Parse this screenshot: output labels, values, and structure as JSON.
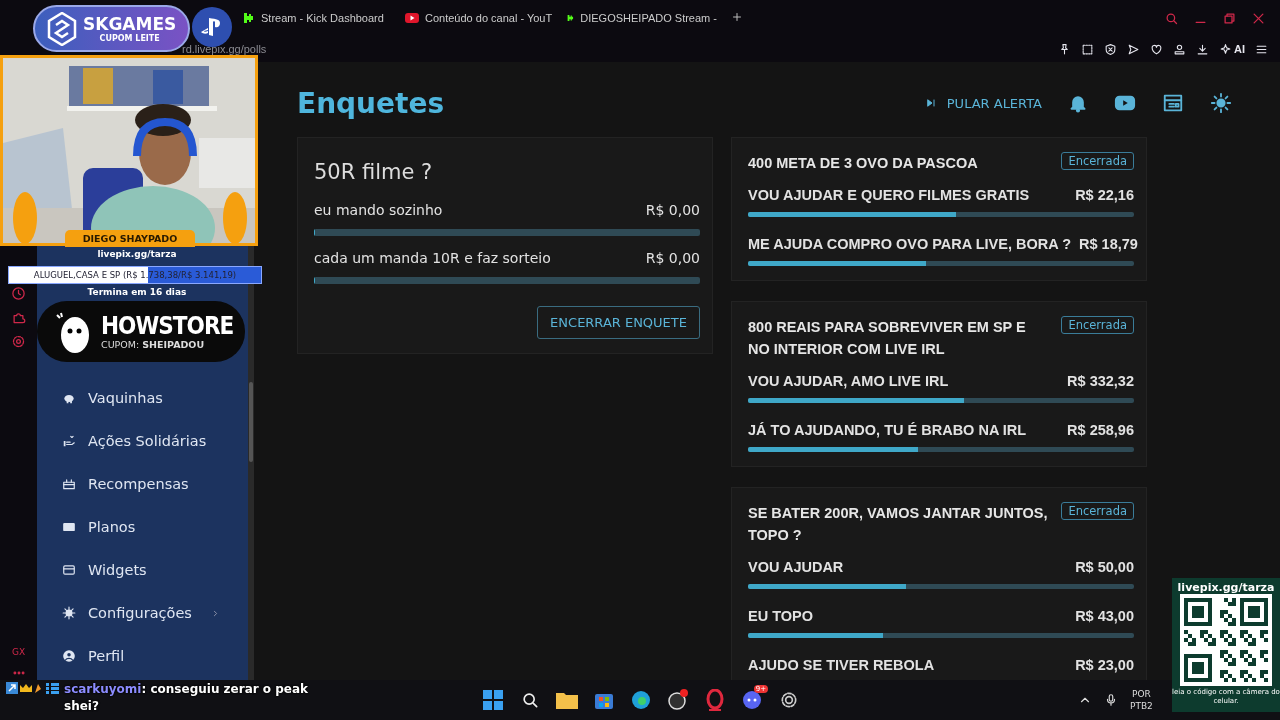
{
  "browser": {
    "tabs": [
      {
        "kind": "kick",
        "title": "Stream - Kick Dashboard"
      },
      {
        "kind": "youtube",
        "title": "Conteúdo do canal - YouT"
      },
      {
        "kind": "kick",
        "title": "DIEGOSHEIPADO Stream -"
      }
    ],
    "address": "rd.livepix.gg/polls",
    "ai_label": "AI"
  },
  "opera_sidebar": {
    "badge": "GX"
  },
  "sidebar": {
    "items": [
      {
        "label": "Vaquinhas",
        "has_submenu": false
      },
      {
        "label": "Ações Solidárias",
        "has_submenu": false
      },
      {
        "label": "Recompensas",
        "has_submenu": false
      },
      {
        "label": "Planos",
        "has_submenu": false
      },
      {
        "label": "Widgets",
        "has_submenu": false
      },
      {
        "label": "Configurações",
        "has_submenu": true
      },
      {
        "label": "Perfil",
        "has_submenu": false
      }
    ]
  },
  "page": {
    "title": "Enquetes",
    "skip_alert": "PULAR ALERTA"
  },
  "active_poll": {
    "title": "50R filme ?",
    "options": [
      {
        "label": "eu mando sozinho",
        "amount": "R$ 0,00",
        "level": 0
      },
      {
        "label": "cada um manda 10R e faz sorteio",
        "amount": "R$ 0,00",
        "level": 0
      }
    ],
    "button": "ENCERRAR ENQUETE"
  },
  "closed_polls": [
    {
      "title": "400 META DE 3 OVO DA PASCOA",
      "status": "Encerrada",
      "options": [
        {
          "label": "VOU AJUDAR E QUERO FILMES GRATIS",
          "amount": "R$ 22,16",
          "level": 0.54
        },
        {
          "label": "ME AJUDA COMPRO OVO PARA LIVE, BORA ?",
          "amount": "R$ 18,79",
          "level": 0.46
        }
      ]
    },
    {
      "title": "800 REAIS PARA SOBREVIVER EM SP E NO INTERIOR COM LIVE IRL",
      "status": "Encerrada",
      "options": [
        {
          "label": "VOU AJUDAR, AMO LIVE IRL",
          "amount": "R$ 332,32",
          "level": 0.56
        },
        {
          "label": "JÁ TO AJUDANDO, TU É BRABO NA IRL",
          "amount": "R$ 258,96",
          "level": 0.44
        }
      ]
    },
    {
      "title": "SE BATER 200R, VAMOS JANTAR JUNTOS, TOPO ?",
      "status": "Encerrada",
      "options": [
        {
          "label": "VOU AJUDAR",
          "amount": "R$ 50,00",
          "level": 0.41
        },
        {
          "label": "EU TOPO",
          "amount": "R$ 43,00",
          "level": 0.35
        },
        {
          "label": "AJUDO SE TIVER REBOLA",
          "amount": "R$ 23,00"
        }
      ]
    }
  ],
  "overlay": {
    "brand": "SKGAMES",
    "brand_coupon": "CUPOM LEITE",
    "streamer": "DIEGO SHAYPADO",
    "goal": {
      "link": "livepix.gg/tarza",
      "label": "ALUGUEL,CASA E SP (R$ 1.738,38/R$ 3.141,19)",
      "level": 0.55,
      "ends": "Termina em 16 dias"
    },
    "sponsor": {
      "name": "HOWSTORE",
      "coupon": "CUPOM: **SHEIPADOU**"
    },
    "qr": {
      "link": "livepix.gg/tarza",
      "caption": "leia o código com a câmera do celular."
    },
    "chat": {
      "user": "scarkuyomi",
      "message": ": conseguiu zerar o peak shei?"
    }
  },
  "taskbar": {
    "discord_badge": "9+",
    "language": "POR",
    "layout": "PTB2"
  }
}
